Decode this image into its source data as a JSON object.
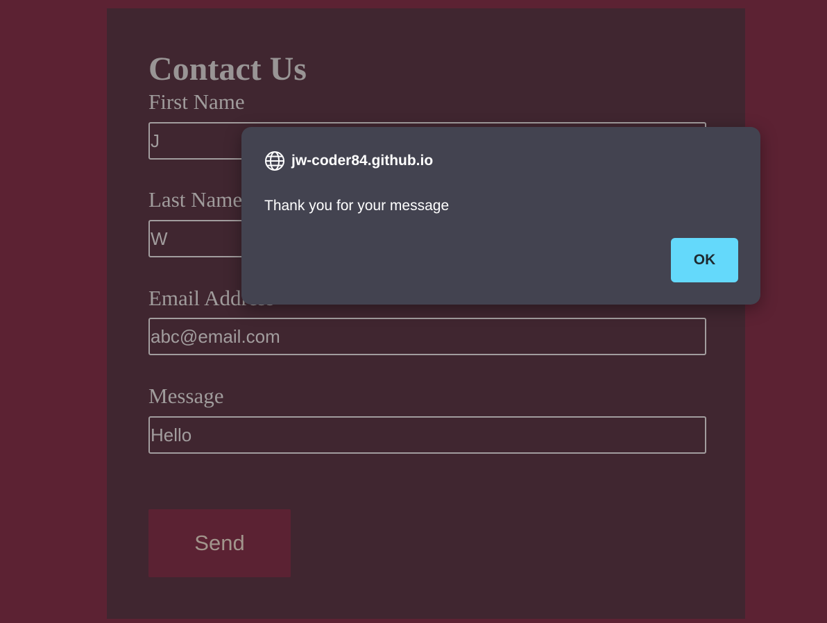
{
  "colors": {
    "page_background": "#5c2233",
    "panel_background": "#402630",
    "dialog_background": "#434350",
    "ok_button": "#64d9fb",
    "send_button": "#5b2233"
  },
  "form": {
    "title": "Contact Us",
    "fields": [
      {
        "label": "First Name",
        "value": "J"
      },
      {
        "label": "Last Name",
        "value": "W"
      },
      {
        "label": "Email Address",
        "value": "abc@email.com"
      },
      {
        "label": "Message",
        "value": "Hello"
      }
    ],
    "send_label": "Send"
  },
  "dialog": {
    "icon": "globe-icon",
    "origin": "jw-coder84.github.io",
    "message": "Thank you for your message",
    "ok_label": "OK"
  }
}
